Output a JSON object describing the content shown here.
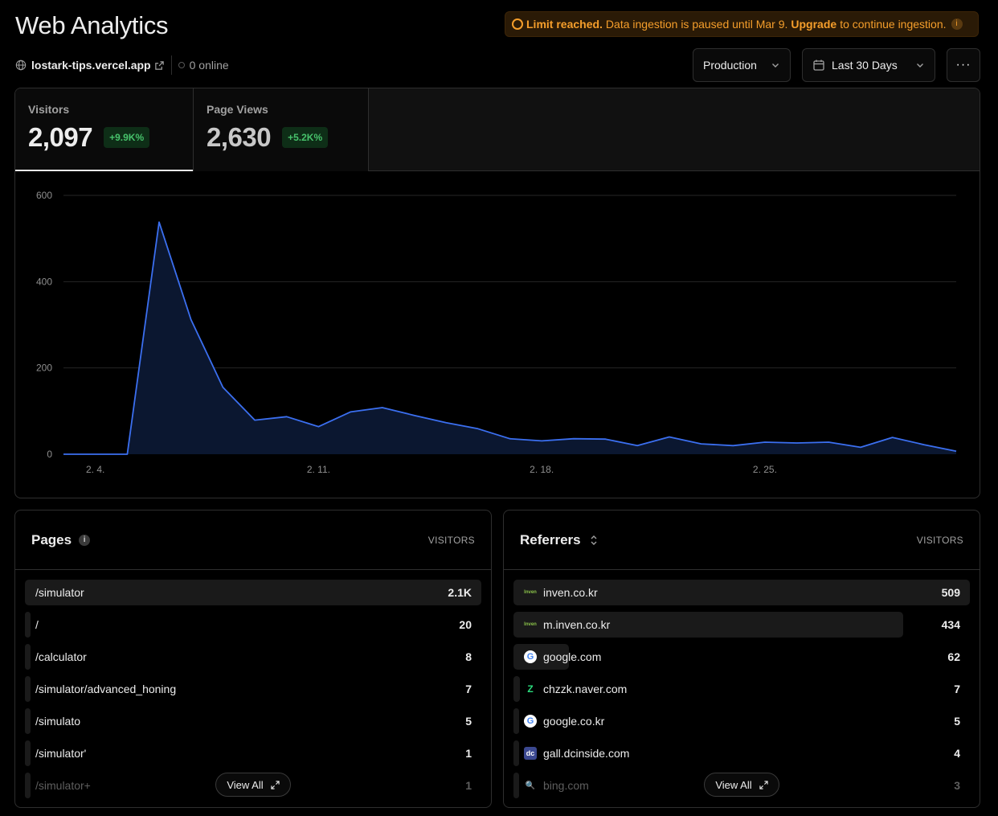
{
  "header": {
    "title": "Web Analytics",
    "banner": {
      "strong": "Limit reached.",
      "text": "Data ingestion is paused until Mar 9.",
      "link": "Upgrade",
      "suffix": "to continue ingestion.",
      "accent_color": "#f59e2b"
    },
    "domain": "lostark-tips.vercel.app",
    "online": "0 online"
  },
  "controls": {
    "environment": "Production",
    "date_range": "Last 30 Days",
    "more": "···"
  },
  "tabs": [
    {
      "label": "Visitors",
      "value": "2,097",
      "change": "+9.9K%"
    },
    {
      "label": "Page Views",
      "value": "2,630",
      "change": "+5.2K%"
    }
  ],
  "chart_data": {
    "type": "area",
    "y_ticks": [
      "600",
      "400",
      "200",
      "0"
    ],
    "ylim": [
      0,
      600
    ],
    "x_tick_labels": [
      "2. 4.",
      "2. 11.",
      "2. 18.",
      "2. 25."
    ],
    "x_tick_index": [
      1,
      8,
      15,
      22
    ],
    "values": [
      0,
      0,
      0,
      538,
      312,
      155,
      79,
      87,
      64,
      98,
      108,
      90,
      73,
      59,
      36,
      31,
      36,
      35,
      20,
      40,
      24,
      20,
      28,
      26,
      28,
      16,
      39,
      22,
      7
    ],
    "line_color": "#3b6ff0",
    "fill_color": "#0b1730"
  },
  "pages": {
    "title": "Pages",
    "column": "VISITORS",
    "view_all": "View All",
    "rows": [
      {
        "label": "/simulator",
        "count": "2.1K",
        "share": 1.0
      },
      {
        "label": "/",
        "count": "20",
        "share": 0.01
      },
      {
        "label": "/calculator",
        "count": "8",
        "share": 0.005
      },
      {
        "label": "/simulator/advanced_honing",
        "count": "7",
        "share": 0.005
      },
      {
        "label": "/simulato",
        "count": "5",
        "share": 0.005
      },
      {
        "label": "/simulator'",
        "count": "1",
        "share": 0.005
      },
      {
        "label": "/simulator+",
        "count": "1",
        "share": 0.005
      }
    ]
  },
  "referrers": {
    "title": "Referrers",
    "column": "VISITORS",
    "view_all": "View All",
    "rows": [
      {
        "label": "inven.co.kr",
        "count": "509",
        "share": 1.0,
        "icon": "inven-icon",
        "glyph": "Inven"
      },
      {
        "label": "m.inven.co.kr",
        "count": "434",
        "share": 0.853,
        "icon": "inven-icon",
        "glyph": "Inven"
      },
      {
        "label": "google.com",
        "count": "62",
        "share": 0.122,
        "icon": "google-icon",
        "glyph": "G"
      },
      {
        "label": "chzzk.naver.com",
        "count": "7",
        "share": 0.014,
        "icon": "chzzk-icon",
        "glyph": "Z"
      },
      {
        "label": "google.co.kr",
        "count": "5",
        "share": 0.01,
        "icon": "google-icon",
        "glyph": "G"
      },
      {
        "label": "gall.dcinside.com",
        "count": "4",
        "share": 0.008,
        "icon": "dcinside-icon",
        "glyph": "dc"
      },
      {
        "label": "bing.com",
        "count": "3",
        "share": 0.006,
        "icon": "bing-icon",
        "glyph": "🔍"
      }
    ]
  }
}
